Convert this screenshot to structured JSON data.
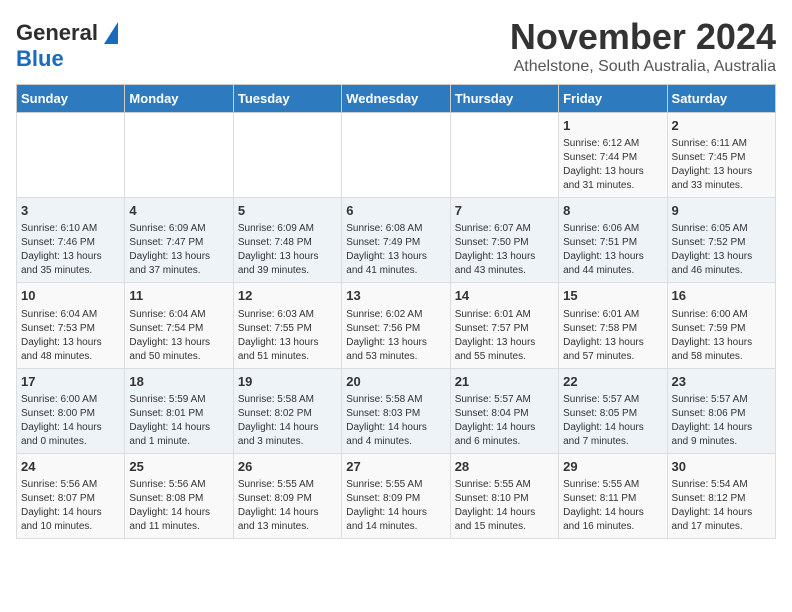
{
  "header": {
    "logo_general": "General",
    "logo_blue": "Blue",
    "title": "November 2024",
    "subtitle": "Athelstone, South Australia, Australia"
  },
  "days_of_week": [
    "Sunday",
    "Monday",
    "Tuesday",
    "Wednesday",
    "Thursday",
    "Friday",
    "Saturday"
  ],
  "weeks": [
    [
      {
        "day": "",
        "info": ""
      },
      {
        "day": "",
        "info": ""
      },
      {
        "day": "",
        "info": ""
      },
      {
        "day": "",
        "info": ""
      },
      {
        "day": "",
        "info": ""
      },
      {
        "day": "1",
        "info": "Sunrise: 6:12 AM\nSunset: 7:44 PM\nDaylight: 13 hours and 31 minutes."
      },
      {
        "day": "2",
        "info": "Sunrise: 6:11 AM\nSunset: 7:45 PM\nDaylight: 13 hours and 33 minutes."
      }
    ],
    [
      {
        "day": "3",
        "info": "Sunrise: 6:10 AM\nSunset: 7:46 PM\nDaylight: 13 hours and 35 minutes."
      },
      {
        "day": "4",
        "info": "Sunrise: 6:09 AM\nSunset: 7:47 PM\nDaylight: 13 hours and 37 minutes."
      },
      {
        "day": "5",
        "info": "Sunrise: 6:09 AM\nSunset: 7:48 PM\nDaylight: 13 hours and 39 minutes."
      },
      {
        "day": "6",
        "info": "Sunrise: 6:08 AM\nSunset: 7:49 PM\nDaylight: 13 hours and 41 minutes."
      },
      {
        "day": "7",
        "info": "Sunrise: 6:07 AM\nSunset: 7:50 PM\nDaylight: 13 hours and 43 minutes."
      },
      {
        "day": "8",
        "info": "Sunrise: 6:06 AM\nSunset: 7:51 PM\nDaylight: 13 hours and 44 minutes."
      },
      {
        "day": "9",
        "info": "Sunrise: 6:05 AM\nSunset: 7:52 PM\nDaylight: 13 hours and 46 minutes."
      }
    ],
    [
      {
        "day": "10",
        "info": "Sunrise: 6:04 AM\nSunset: 7:53 PM\nDaylight: 13 hours and 48 minutes."
      },
      {
        "day": "11",
        "info": "Sunrise: 6:04 AM\nSunset: 7:54 PM\nDaylight: 13 hours and 50 minutes."
      },
      {
        "day": "12",
        "info": "Sunrise: 6:03 AM\nSunset: 7:55 PM\nDaylight: 13 hours and 51 minutes."
      },
      {
        "day": "13",
        "info": "Sunrise: 6:02 AM\nSunset: 7:56 PM\nDaylight: 13 hours and 53 minutes."
      },
      {
        "day": "14",
        "info": "Sunrise: 6:01 AM\nSunset: 7:57 PM\nDaylight: 13 hours and 55 minutes."
      },
      {
        "day": "15",
        "info": "Sunrise: 6:01 AM\nSunset: 7:58 PM\nDaylight: 13 hours and 57 minutes."
      },
      {
        "day": "16",
        "info": "Sunrise: 6:00 AM\nSunset: 7:59 PM\nDaylight: 13 hours and 58 minutes."
      }
    ],
    [
      {
        "day": "17",
        "info": "Sunrise: 6:00 AM\nSunset: 8:00 PM\nDaylight: 14 hours and 0 minutes."
      },
      {
        "day": "18",
        "info": "Sunrise: 5:59 AM\nSunset: 8:01 PM\nDaylight: 14 hours and 1 minute."
      },
      {
        "day": "19",
        "info": "Sunrise: 5:58 AM\nSunset: 8:02 PM\nDaylight: 14 hours and 3 minutes."
      },
      {
        "day": "20",
        "info": "Sunrise: 5:58 AM\nSunset: 8:03 PM\nDaylight: 14 hours and 4 minutes."
      },
      {
        "day": "21",
        "info": "Sunrise: 5:57 AM\nSunset: 8:04 PM\nDaylight: 14 hours and 6 minutes."
      },
      {
        "day": "22",
        "info": "Sunrise: 5:57 AM\nSunset: 8:05 PM\nDaylight: 14 hours and 7 minutes."
      },
      {
        "day": "23",
        "info": "Sunrise: 5:57 AM\nSunset: 8:06 PM\nDaylight: 14 hours and 9 minutes."
      }
    ],
    [
      {
        "day": "24",
        "info": "Sunrise: 5:56 AM\nSunset: 8:07 PM\nDaylight: 14 hours and 10 minutes."
      },
      {
        "day": "25",
        "info": "Sunrise: 5:56 AM\nSunset: 8:08 PM\nDaylight: 14 hours and 11 minutes."
      },
      {
        "day": "26",
        "info": "Sunrise: 5:55 AM\nSunset: 8:09 PM\nDaylight: 14 hours and 13 minutes."
      },
      {
        "day": "27",
        "info": "Sunrise: 5:55 AM\nSunset: 8:09 PM\nDaylight: 14 hours and 14 minutes."
      },
      {
        "day": "28",
        "info": "Sunrise: 5:55 AM\nSunset: 8:10 PM\nDaylight: 14 hours and 15 minutes."
      },
      {
        "day": "29",
        "info": "Sunrise: 5:55 AM\nSunset: 8:11 PM\nDaylight: 14 hours and 16 minutes."
      },
      {
        "day": "30",
        "info": "Sunrise: 5:54 AM\nSunset: 8:12 PM\nDaylight: 14 hours and 17 minutes."
      }
    ]
  ]
}
